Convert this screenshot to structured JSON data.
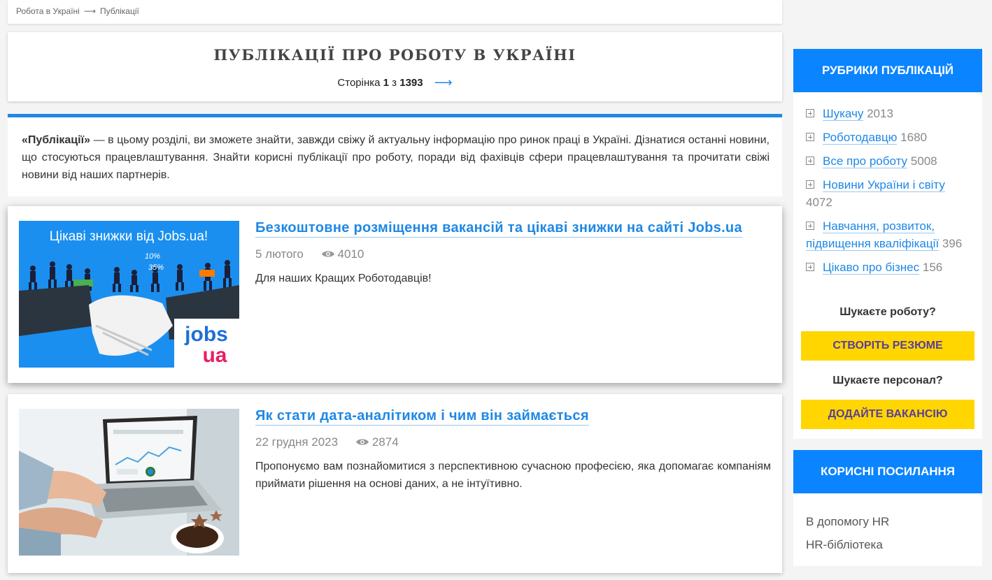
{
  "breadcrumb": {
    "home": "Робота в Україні",
    "separator": "⟶",
    "current": "Публікації"
  },
  "page": {
    "title": "ПУБЛІКАЦІЇ ПРО РОБОТУ В УКРАЇНІ",
    "pager_prefix": "Сторінка",
    "current_page": "1",
    "pager_of": "з",
    "total_pages": "1393",
    "next_arrow": "⟶"
  },
  "intro": {
    "bold": "«Публікації»",
    "text": " — в цьому розділі, ви зможете знайти, завжди свіжу й актуальну інформацію про ринок праці в Україні. Дізнатися останні новини, що стосуються працевлаштування. Знайти корисні публікації про роботу, поради від фахівців сфери працевлаштування та прочитати свіжі новини від наших партнерів."
  },
  "articles": [
    {
      "title": "Безкоштовне розміщення вакансій та цікаві знижки на сайті Jobs.ua",
      "date": "5 лютого",
      "views": "4010",
      "excerpt": "Для наших Кращих Роботодавців!",
      "image": {
        "headline": "Цікаві знижки від Jobs.ua!",
        "badge1": "10%",
        "badge2": "35%",
        "logo_top": "jobs",
        "logo_bottom": "ua"
      }
    },
    {
      "title": "Як стати дата-аналітиком і чим він займається",
      "date": "22 грудня 2023",
      "views": "2874",
      "excerpt": "Пропонуємо вам познайомитися з перспективною сучасною професією, яка допомагає компаніям приймати рішення на основі даних, а не інтуїтивно."
    }
  ],
  "sidebar": {
    "rubrics_title": "РУБРИКИ ПУБЛІКАЦІЙ",
    "rubrics": [
      {
        "label": "Шукачу",
        "count": "2013"
      },
      {
        "label": "Роботодавцю",
        "count": "1680"
      },
      {
        "label": "Все про роботу",
        "count": "5008"
      },
      {
        "label": "Новини України і світу",
        "count": "4072"
      },
      {
        "label": "Навчання, розвиток, підвищення кваліфікації",
        "count": "396"
      },
      {
        "label": "Цікаво про бізнес",
        "count": "156"
      }
    ],
    "cta": {
      "question1": "Шукаєте роботу?",
      "button1": "СТВОРІТЬ РЕЗЮМЕ",
      "question2": "Шукаєте персонал?",
      "button2": "ДОДАЙТЕ ВАКАНСІЮ"
    },
    "links_title": "КОРИСНІ ПОСИЛАННЯ",
    "links": [
      "В допомогу HR",
      "HR-бібліотека"
    ]
  },
  "colors": {
    "accent": "#1e88e5",
    "sidebar_header": "#0a84ff",
    "cta_button": "#ffd600",
    "cta_text": "#5b3d9a"
  },
  "icons": {
    "views": "eye-icon",
    "rubric_bullet": "plus-square-icon",
    "next": "arrow-right-icon"
  }
}
